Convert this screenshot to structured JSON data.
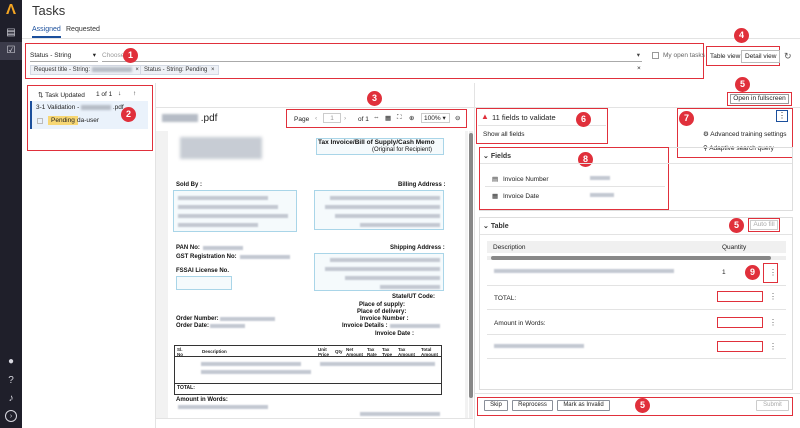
{
  "app": {
    "title": "Tasks"
  },
  "tabs": [
    {
      "label": "Assigned",
      "active": true
    },
    {
      "label": "Requested",
      "active": false
    }
  ],
  "filter": {
    "field_select": "Status - String",
    "choose_placeholder": "Choose",
    "my_open_tasks_label": "My open tasks",
    "chips": [
      "Request title - String:",
      "Status - String: Pending"
    ]
  },
  "view_toggle": {
    "table_view": "Table view",
    "detail_view": "Detail view"
  },
  "task_list": {
    "sort_label": "Task Updated",
    "pagination": "1 of 1",
    "item": {
      "title_prefix": "3-1 Validation -",
      "title_suffix": ".pdf",
      "status": "Pending",
      "user": "da-user"
    }
  },
  "pdf": {
    "filename": ".pdf",
    "page_label": "Page",
    "page_value": "1",
    "of_label": "of 1",
    "zoom": "100%",
    "texts": {
      "title": "Tax Invoice/Bill of Supply/Cash Memo",
      "subtitle": "(Original for Recipient)",
      "sold_by": "Sold By :",
      "billing_address": "Billing Address :",
      "pan": "PAN No:",
      "gst": "GST Registration No:",
      "fssai": "FSSAI License No.",
      "shipping_address": "Shipping Address :",
      "state_ut": "State/UT Code:",
      "place_supply": "Place of supply:",
      "place_delivery": "Place of delivery:",
      "order_number": "Order Number:",
      "invoice_number": "Invoice Number :",
      "order_date": "Order Date:",
      "invoice_details": "Invoice Details :",
      "invoice_date": "Invoice Date :",
      "total": "TOTAL:",
      "amount_words": "Amount in Words:",
      "table_cols": [
        "Sl. No",
        "Description",
        "Unit Price",
        "Qty",
        "Net Amount",
        "Tax Rate",
        "Tax Type",
        "Tax Amount",
        "Total Amount"
      ]
    }
  },
  "validation": {
    "fields_to_validate": "11 fields to validate",
    "show_all_fields": "Show all fields",
    "open_fullscreen": "Open in fullscreen"
  },
  "menu": {
    "advanced_training": "Advanced training settings",
    "adaptive_search": "Adaptive search query"
  },
  "fields_panel": {
    "header": "Fields",
    "fields": [
      {
        "label": "Invoice Number"
      },
      {
        "label": "Invoice Date"
      }
    ]
  },
  "table_panel": {
    "header": "Table",
    "auto_fill": "Auto fill",
    "columns": [
      "Description",
      "Quantity"
    ],
    "row_quantity": "1",
    "rows": [
      "TOTAL:",
      "Amount in Words:"
    ]
  },
  "footer": {
    "skip": "Skip",
    "reprocess": "Reprocess",
    "mark_invalid": "Mark as Invalid",
    "submit": "Submit"
  },
  "annotations": [
    "1",
    "2",
    "3",
    "4",
    "5",
    "6",
    "7",
    "8",
    "5",
    "9",
    "5"
  ],
  "colors": {
    "accent": "#1b4f9c",
    "annotation": "#e0303b",
    "pending": "#f7d774",
    "rail": "#1f1f2a"
  }
}
